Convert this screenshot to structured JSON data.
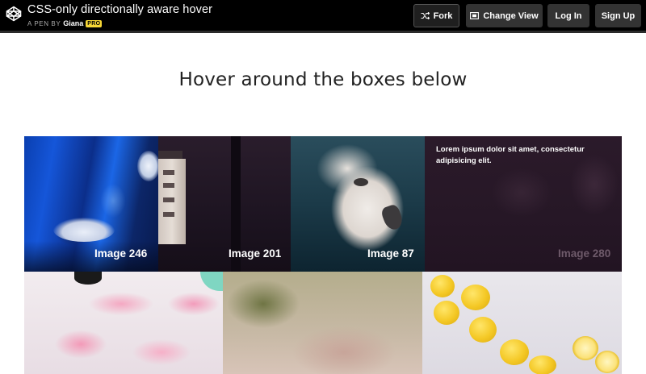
{
  "header": {
    "title": "CSS-only directionally aware hover",
    "byline_prefix": "A PEN BY",
    "author": "Giana",
    "badge": "PRO",
    "buttons": {
      "fork": "Fork",
      "change_view": "Change View",
      "login": "Log In",
      "signup": "Sign Up"
    }
  },
  "main": {
    "heading": "Hover around the boxes below",
    "tiles": [
      {
        "label": "Image 246"
      },
      {
        "label": "Image 201"
      },
      {
        "label": "Image 87"
      },
      {
        "label": "Image 280",
        "caption": "Lorem ipsum dolor sit amet, consectetur adipisicing elit."
      }
    ]
  },
  "colors": {
    "topbar_bg": "#000000",
    "button_bg": "#333333",
    "pro_badge": "#f7d736"
  },
  "icons": [
    "codepen-logo-icon",
    "fork-icon",
    "change-view-icon"
  ]
}
